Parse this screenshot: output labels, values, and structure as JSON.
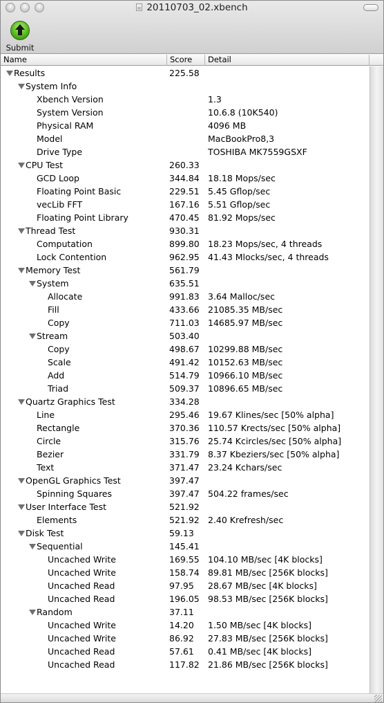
{
  "window": {
    "title": "20110703_02.xbench"
  },
  "toolbar": {
    "submit_label": "Submit"
  },
  "columns": {
    "name": "Name",
    "score": "Score",
    "detail": "Detail"
  },
  "rows": [
    {
      "name": "Results",
      "score": "225.58",
      "detail": "",
      "level": 0,
      "expandable": true
    },
    {
      "name": "System Info",
      "score": "",
      "detail": "",
      "level": 1,
      "expandable": true
    },
    {
      "name": "Xbench Version",
      "score": "",
      "detail": "1.3",
      "level": 2,
      "expandable": false
    },
    {
      "name": "System Version",
      "score": "",
      "detail": "10.6.8 (10K540)",
      "level": 2,
      "expandable": false
    },
    {
      "name": "Physical RAM",
      "score": "",
      "detail": "4096 MB",
      "level": 2,
      "expandable": false
    },
    {
      "name": "Model",
      "score": "",
      "detail": "MacBookPro8,3",
      "level": 2,
      "expandable": false
    },
    {
      "name": "Drive Type",
      "score": "",
      "detail": "TOSHIBA MK7559GSXF",
      "level": 2,
      "expandable": false
    },
    {
      "name": "CPU Test",
      "score": "260.33",
      "detail": "",
      "level": 1,
      "expandable": true
    },
    {
      "name": "GCD Loop",
      "score": "344.84",
      "detail": "18.18 Mops/sec",
      "level": 2,
      "expandable": false
    },
    {
      "name": "Floating Point Basic",
      "score": "229.51",
      "detail": "5.45 Gflop/sec",
      "level": 2,
      "expandable": false
    },
    {
      "name": "vecLib FFT",
      "score": "167.16",
      "detail": "5.51 Gflop/sec",
      "level": 2,
      "expandable": false
    },
    {
      "name": "Floating Point Library",
      "score": "470.45",
      "detail": "81.92 Mops/sec",
      "level": 2,
      "expandable": false
    },
    {
      "name": "Thread Test",
      "score": "930.31",
      "detail": "",
      "level": 1,
      "expandable": true
    },
    {
      "name": "Computation",
      "score": "899.80",
      "detail": "18.23 Mops/sec, 4 threads",
      "level": 2,
      "expandable": false
    },
    {
      "name": "Lock Contention",
      "score": "962.95",
      "detail": "41.43 Mlocks/sec, 4 threads",
      "level": 2,
      "expandable": false
    },
    {
      "name": "Memory Test",
      "score": "561.79",
      "detail": "",
      "level": 1,
      "expandable": true
    },
    {
      "name": "System",
      "score": "635.51",
      "detail": "",
      "level": 2,
      "expandable": true
    },
    {
      "name": "Allocate",
      "score": "991.83",
      "detail": "3.64 Malloc/sec",
      "level": 3,
      "expandable": false
    },
    {
      "name": "Fill",
      "score": "433.66",
      "detail": "21085.35 MB/sec",
      "level": 3,
      "expandable": false
    },
    {
      "name": "Copy",
      "score": "711.03",
      "detail": "14685.97 MB/sec",
      "level": 3,
      "expandable": false
    },
    {
      "name": "Stream",
      "score": "503.40",
      "detail": "",
      "level": 2,
      "expandable": true
    },
    {
      "name": "Copy",
      "score": "498.67",
      "detail": "10299.88 MB/sec",
      "level": 3,
      "expandable": false
    },
    {
      "name": "Scale",
      "score": "491.42",
      "detail": "10152.63 MB/sec",
      "level": 3,
      "expandable": false
    },
    {
      "name": "Add",
      "score": "514.79",
      "detail": "10966.10 MB/sec",
      "level": 3,
      "expandable": false
    },
    {
      "name": "Triad",
      "score": "509.37",
      "detail": "10896.65 MB/sec",
      "level": 3,
      "expandable": false
    },
    {
      "name": "Quartz Graphics Test",
      "score": "334.28",
      "detail": "",
      "level": 1,
      "expandable": true
    },
    {
      "name": "Line",
      "score": "295.46",
      "detail": "19.67 Klines/sec [50% alpha]",
      "level": 2,
      "expandable": false
    },
    {
      "name": "Rectangle",
      "score": "370.36",
      "detail": "110.57 Krects/sec [50% alpha]",
      "level": 2,
      "expandable": false
    },
    {
      "name": "Circle",
      "score": "315.76",
      "detail": "25.74 Kcircles/sec [50% alpha]",
      "level": 2,
      "expandable": false
    },
    {
      "name": "Bezier",
      "score": "331.79",
      "detail": "8.37 Kbeziers/sec [50% alpha]",
      "level": 2,
      "expandable": false
    },
    {
      "name": "Text",
      "score": "371.47",
      "detail": "23.24 Kchars/sec",
      "level": 2,
      "expandable": false
    },
    {
      "name": "OpenGL Graphics Test",
      "score": "397.47",
      "detail": "",
      "level": 1,
      "expandable": true
    },
    {
      "name": "Spinning Squares",
      "score": "397.47",
      "detail": "504.22 frames/sec",
      "level": 2,
      "expandable": false
    },
    {
      "name": "User Interface Test",
      "score": "521.92",
      "detail": "",
      "level": 1,
      "expandable": true
    },
    {
      "name": "Elements",
      "score": "521.92",
      "detail": "2.40 Krefresh/sec",
      "level": 2,
      "expandable": false
    },
    {
      "name": "Disk Test",
      "score": "59.13",
      "detail": "",
      "level": 1,
      "expandable": true
    },
    {
      "name": "Sequential",
      "score": "145.41",
      "detail": "",
      "level": 2,
      "expandable": true
    },
    {
      "name": "Uncached Write",
      "score": "169.55",
      "detail": "104.10 MB/sec [4K blocks]",
      "level": 3,
      "expandable": false
    },
    {
      "name": "Uncached Write",
      "score": "158.74",
      "detail": "89.81 MB/sec [256K blocks]",
      "level": 3,
      "expandable": false
    },
    {
      "name": "Uncached Read",
      "score": "97.95",
      "detail": "28.67 MB/sec [4K blocks]",
      "level": 3,
      "expandable": false
    },
    {
      "name": "Uncached Read",
      "score": "196.05",
      "detail": "98.53 MB/sec [256K blocks]",
      "level": 3,
      "expandable": false
    },
    {
      "name": "Random",
      "score": "37.11",
      "detail": "",
      "level": 2,
      "expandable": true
    },
    {
      "name": "Uncached Write",
      "score": "14.20",
      "detail": "1.50 MB/sec [4K blocks]",
      "level": 3,
      "expandable": false
    },
    {
      "name": "Uncached Write",
      "score": "86.92",
      "detail": "27.83 MB/sec [256K blocks]",
      "level": 3,
      "expandable": false
    },
    {
      "name": "Uncached Read",
      "score": "57.61",
      "detail": "0.41 MB/sec [4K blocks]",
      "level": 3,
      "expandable": false
    },
    {
      "name": "Uncached Read",
      "score": "117.82",
      "detail": "21.86 MB/sec [256K blocks]",
      "level": 3,
      "expandable": false
    }
  ]
}
